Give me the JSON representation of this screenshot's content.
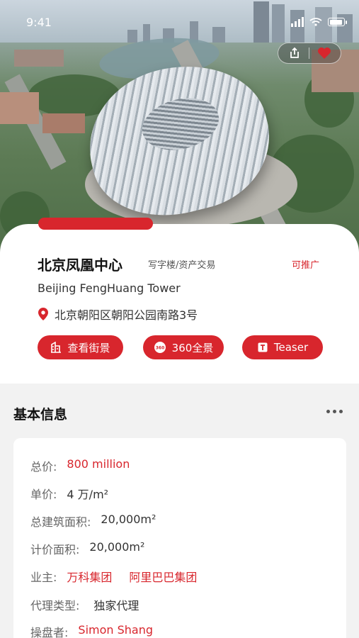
{
  "status_bar": {
    "time": "9:41"
  },
  "property": {
    "title": "北京凤凰中心",
    "category": "写字楼/资产交易",
    "promo_tag": "可推广",
    "subtitle": "Beijing FengHuang Tower",
    "address": "北京朝阳区朝阳公园南路3号"
  },
  "buttons": {
    "street_view": "查看街景",
    "panorama": "360全景",
    "teaser": "Teaser"
  },
  "basic_info": {
    "section_title": "基本信息",
    "rows": [
      {
        "label": "总价:",
        "value": "800 million"
      },
      {
        "label": "单价:",
        "value": "4 万/m²"
      },
      {
        "label": "总建筑面积:",
        "value": "20,000m²"
      },
      {
        "label": "计价面积:",
        "value": "20,000m²"
      },
      {
        "label": "业主:",
        "value": "万科集团",
        "value2": "阿里巴巴集团"
      },
      {
        "label": "代理类型:",
        "value": "独家代理"
      },
      {
        "label": "操盘者:",
        "value": "Simon Shang"
      }
    ]
  },
  "icons": {
    "share": "share-icon",
    "favorite": "heart-icon",
    "location": "location-pin-icon",
    "building": "building-icon",
    "panorama": "360-icon",
    "document": "document-icon",
    "more": "more-icon"
  },
  "colors": {
    "accent": "#d8262d"
  }
}
